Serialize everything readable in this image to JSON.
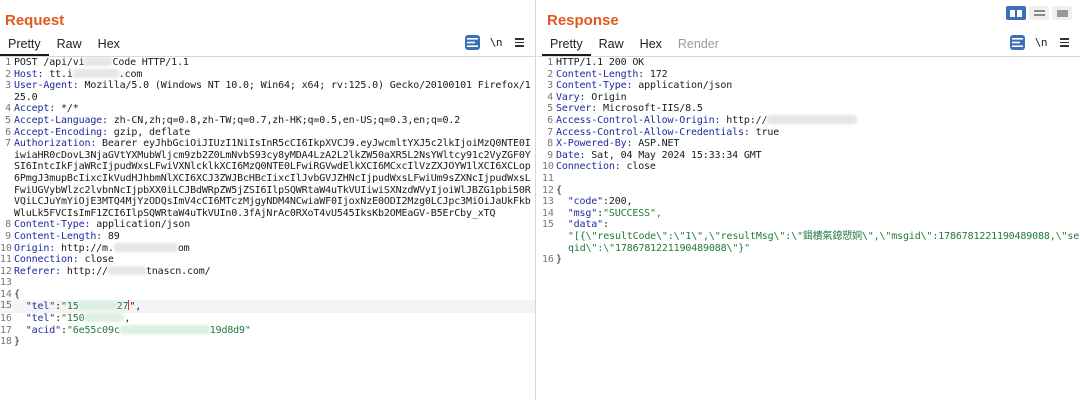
{
  "colors": {
    "accent": "#e05a1f",
    "key": "#1e2aa0",
    "string": "#1f7a3a",
    "button": "#3d6fb6"
  },
  "request": {
    "title": "Request",
    "tabs": [
      "Pretty",
      "Raw",
      "Hex"
    ],
    "newline_label": "\\n",
    "lines": {
      "l1a": "POST /api/vi",
      "l1b": "Code HTTP/1.1",
      "l2k": "Host:",
      "l2a": " tt.i",
      "l2b": ".com",
      "l3k": "User-Agent:",
      "l3v": " Mozilla/5.0 (Windows NT 10.0; Win64; x64; rv:125.0) Gecko/20100101 Firefox/125.0",
      "l4k": "Accept:",
      "l4v": " */*",
      "l5k": "Accept-Language:",
      "l5v": " zh-CN,zh;q=0.8,zh-TW;q=0.7,zh-HK;q=0.5,en-US;q=0.3,en;q=0.2",
      "l6k": "Accept-Encoding:",
      "l6v": " gzip, deflate",
      "l7k": "Authorization:",
      "l7v": " Bearer eyJhbGciOiJIUzI1NiIsInR5cCI6IkpXVCJ9.eyJwcmltYXJ5c2lkIjoiMzQ0NTE0IiwiaHR0cDovL3NjaGVtYXMubWljcm9zb2Z0LmNvbS93cy8yMDA4LzA2L2lkZW50aXR5L2NsYWltcy91c2VyZGF0YSI6IntcIkFjaWRcIjpudWxsLFwiVXNlcklkXCI6MzQ0NTE0LFwiRGVwdElkXCI6MCxcIlVzZXJOYW1lXCI6XCLop6PmgJ3mupBcIixcIkVudHJhbmNlXCI6XCJ3ZWJBcHBcIixcIlJvbGVJZHNcIjpudWxsLFwiUm9sZXNcIjpudWxsLFwiUGVybWlzc2lvbnNcIjpbXX0iLCJBdWRpZW5jZSI6IlpSQWRtaW4uTkVUIiwiSXNzdWVyIjoiWlJBZG1pbi50RVQiLCJuYmYiOjE3MTQ4MjYzODQsImV4cCI6MTczMjgyNDM4NCwiaWF0IjoxNzE0ODI2Mzg0LCJpc3MiOiJaUkFkbWluLk5FVCIsImF1ZCI6IlpSQWRtaW4uTkVUIn0.3fAjNrAc0RXoT4vU545IksKb2OMEaGV-B5ErCby_xTQ",
      "l8k": "Content-Type:",
      "l8v": " application/json",
      "l9k": "Content-Length:",
      "l9v": " 89",
      "l10k": "Origin:",
      "l10a": " http://m.",
      "l10b": "om",
      "l11k": "Connection:",
      "l11v": " close",
      "l12k": "Referer:",
      "l12a": " http://",
      "l12b": "tnascn.com/",
      "l14": "{",
      "l15k": "\"tel\"",
      "l15a": "\"15",
      "l15b": "27",
      "l16k": "\"tel\"",
      "l16a": "\"150",
      "l16b": ",",
      "l17k": "\"acid\"",
      "l17a": "\"6e55c09c",
      "l17b": "19d8d9\"",
      "l18": "}"
    },
    "numbers": [
      "1",
      "2",
      "3",
      "",
      "4",
      "5",
      "6",
      "7",
      "",
      "",
      "",
      "",
      "",
      "",
      "8",
      "9",
      "10",
      "11",
      "12",
      "13",
      "14",
      "15",
      "16",
      "17",
      "18"
    ]
  },
  "response": {
    "title": "Response",
    "tabs": [
      "Pretty",
      "Raw",
      "Hex",
      "Render"
    ],
    "newline_label": "\\n",
    "lines": {
      "l1": "HTTP/1.1 200 OK",
      "l2k": "Content-Length:",
      "l2v": " 172",
      "l3k": "Content-Type:",
      "l3v": " application/json",
      "l4k": "Vary:",
      "l4v": " Origin",
      "l5k": "Server:",
      "l5v": " Microsoft-IIS/8.5",
      "l6k": "Access-Control-Allow-Origin:",
      "l6v": " http://",
      "l7k": "Access-Control-Allow-Credentials:",
      "l7v": " true",
      "l8k": "X-Powered-By:",
      "l8v": " ASP.NET",
      "l9k": "Date:",
      "l9v": " Sat, 04 May 2024 15:33:34 GMT",
      "l10k": "Connection:",
      "l10v": " close",
      "l12": "{",
      "l13k": "\"code\"",
      "l13v": "200,",
      "l14k": "\"msg\"",
      "l14v": "\"SUCCESS\",",
      "l15k": "\"data\"",
      "l15v": "\"[{\\\"resultCode\\\":\\\"1\\\",\\\"resultMsg\\\":\\\"鍓樻氣鎴愬姛\\\",\\\"msgid\\\":1786781221190489088,\\\"seqid\\\":\\\"1786781221190489088\\\"}\"",
      "l16": "}"
    },
    "numbers": [
      "1",
      "2",
      "3",
      "4",
      "5",
      "6",
      "7",
      "8",
      "9",
      "10",
      "11",
      "12",
      "13",
      "14",
      "15",
      "",
      "16"
    ]
  }
}
